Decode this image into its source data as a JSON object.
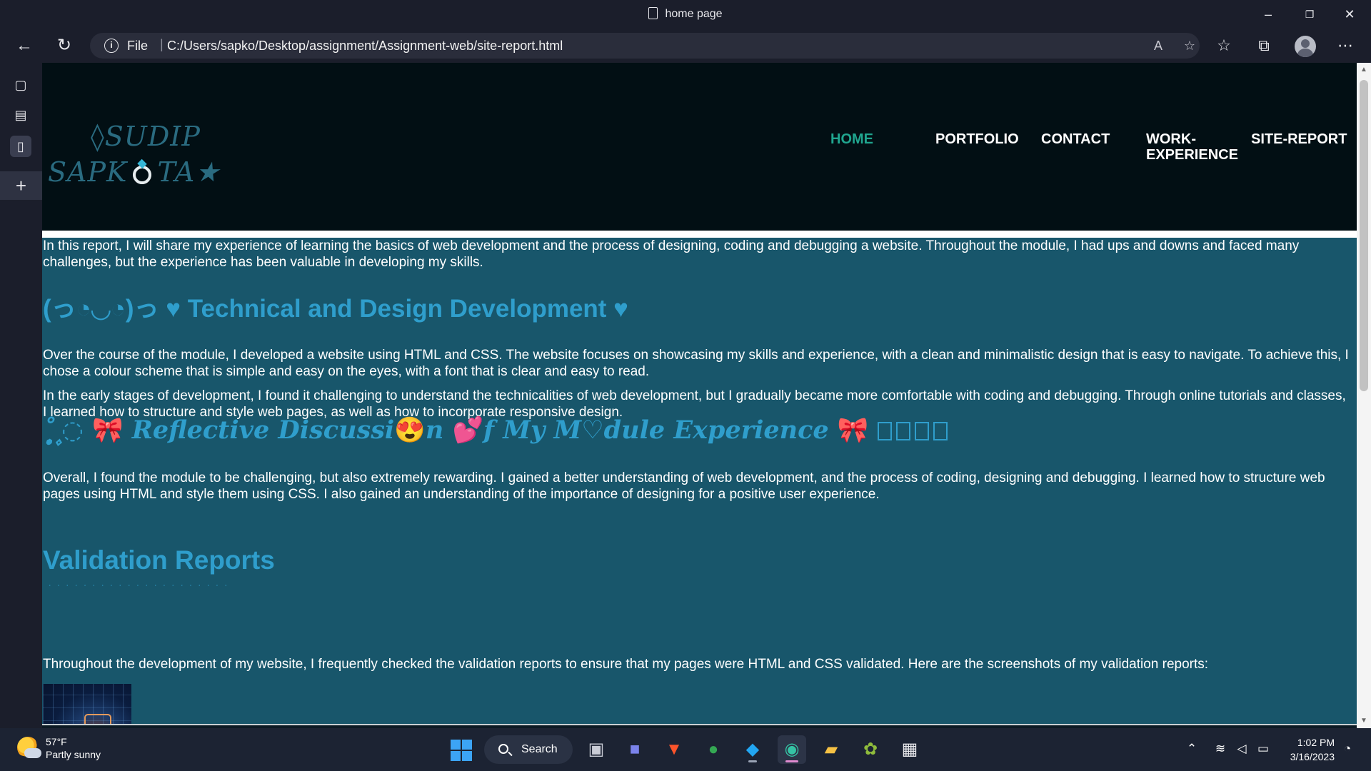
{
  "browser": {
    "window_title": "home page",
    "address": {
      "protocol": "File",
      "url": "C:/Users/sapko/Desktop/assignment/Assignment-web/site-report.html"
    }
  },
  "site": {
    "logo": {
      "line1": "◊SUDIP",
      "line2a": "SAPK",
      "line2b": "TA★"
    },
    "nav": {
      "home": "HOME",
      "portfolio": "PORTFOLIO",
      "contact": "CONTACT",
      "work1": "WORK-",
      "work2": "EXPERIENCE",
      "site_report": "SITE-REPORT"
    },
    "intro": "In this report, I will share my experience of learning the basics of web development and the process of designing, coding and debugging a website. Throughout the module, I had ups and downs and faced many challenges, but the experience has been valuable in developing my skills.",
    "technical": {
      "heading": "(っ◔◡◔)っ ♥ Technical and Design Development ♥",
      "p1": "Over the course of the module, I developed a website using HTML and CSS. The website focuses on showcasing my skills and experience, with a clean and minimalistic design that is easy to navigate. To achieve this, I chose a colour scheme that is simple and easy on the eyes, with a font that is clear and easy to read.",
      "p2": "In the early stages of development, I found it challenging to understand the technicalities of web development, but I gradually became more comfortable with coding and debugging. Through online tutorials and classes, I learned how to structure and style web pages, as well as how to incorporate responsive design."
    },
    "reflective": {
      "prefix": "˚ ͙۪۪̥◌ ",
      "bow": "🎀",
      "part1": "Reflective Discussi",
      "emoji1": "😍",
      "part2": "n",
      "emoji2": "💕",
      "part3": "f My M♡dule Experience",
      "p1": "Overall, I found the module to be challenging, but also extremely rewarding. I gained a better understanding of web development, and the process of coding, designing and debugging. I learned how to structure web pages using HTML and style them using CSS. I also gained an understanding of the importance of designing for a positive user experience."
    },
    "validation": {
      "heading": "Validation Reports",
      "p1": "Throughout the development of my website, I frequently checked the validation reports to ensure that my pages were HTML and CSS validated. Here are the screenshots of my validation reports:"
    }
  },
  "taskbar": {
    "weather_temp": "57°F",
    "weather_desc": "Partly sunny",
    "search_label": "Search",
    "time": "1:02 PM",
    "date": "3/16/2023"
  },
  "colors": {
    "page_bg": "#18566b",
    "header_bg": "#020f14",
    "heading": "#2f9ecc",
    "nav_active": "#20a58f"
  }
}
